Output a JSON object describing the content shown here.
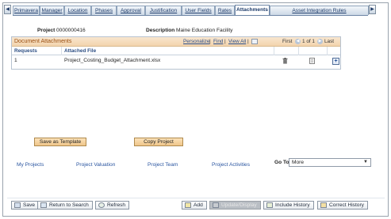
{
  "tabs": [
    {
      "label": "Primavera",
      "active": false
    },
    {
      "label": "Manager",
      "active": false
    },
    {
      "label": "Location",
      "active": false
    },
    {
      "label": "Phases",
      "active": false
    },
    {
      "label": "Approval",
      "active": false
    },
    {
      "label": "Justification",
      "active": false
    },
    {
      "label": "User Fields",
      "active": false
    },
    {
      "label": "Rates",
      "active": false
    },
    {
      "label": "Attachments",
      "active": true
    },
    {
      "label": "Asset Integration Rules",
      "active": false
    }
  ],
  "tab_nav": {
    "prev": "◀",
    "next": "▶"
  },
  "header": {
    "project_label": "Project",
    "project_value": "0000000416",
    "description_label": "Description",
    "description_value": "Maine Education Facility"
  },
  "grid": {
    "title": "Document Attachments",
    "personalize": "Personalize",
    "find": "Find",
    "view_all": "View All",
    "separator": "|",
    "first": "First",
    "counter": "1 of 1",
    "last": "Last",
    "columns": [
      "Requests",
      "Attached File"
    ],
    "rows": [
      {
        "request": "1",
        "file": "Project_Costing_Budget_Attachment.xlsx"
      }
    ],
    "add_row": "+"
  },
  "buttons": {
    "save_as_template": "Save as Template",
    "copy_project": "Copy Project"
  },
  "links": [
    "My Projects",
    "Project Valuation",
    "Project Team",
    "Project Activities"
  ],
  "goto": {
    "label": "Go To",
    "value": "More"
  },
  "toolbar": {
    "save": "Save",
    "return_to_search": "Return to Search",
    "refresh": "Refresh",
    "add": "Add",
    "update_display": "Update/Display",
    "include_history": "Include History",
    "correct_history": "Correct History"
  }
}
